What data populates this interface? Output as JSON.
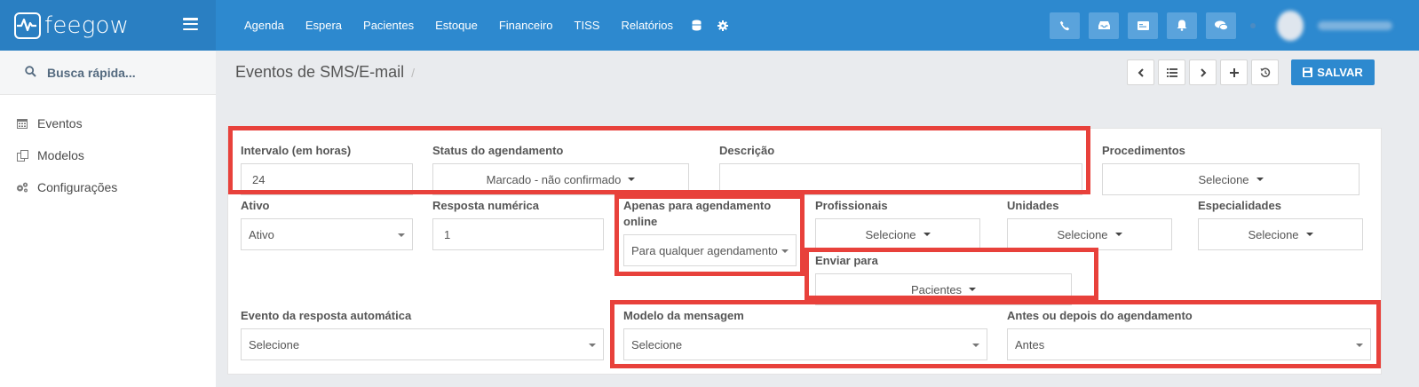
{
  "brand": {
    "name": "feegow"
  },
  "topnav": {
    "items": [
      "Agenda",
      "Espera",
      "Pacientes",
      "Estoque",
      "Financeiro",
      "TISS",
      "Relatórios"
    ]
  },
  "sidebar": {
    "search_placeholder": "Busca rápida...",
    "items": [
      {
        "label": "Eventos",
        "icon": "calendar-icon"
      },
      {
        "label": "Modelos",
        "icon": "copy-icon"
      },
      {
        "label": "Configurações",
        "icon": "cogs-icon"
      }
    ]
  },
  "page": {
    "title": "Eventos de SMS/E-mail",
    "separator": "/",
    "save_label": "SALVAR"
  },
  "form": {
    "intervalo": {
      "label": "Intervalo (em horas)",
      "value": "24"
    },
    "status": {
      "label": "Status do agendamento",
      "value": "Marcado - não confirmado"
    },
    "descricao": {
      "label": "Descrição",
      "value": ""
    },
    "procedimentos": {
      "label": "Procedimentos",
      "value": "Selecione"
    },
    "ativo": {
      "label": "Ativo",
      "value": "Ativo"
    },
    "resposta_numerica": {
      "label": "Resposta numérica",
      "value": "1"
    },
    "apenas_online": {
      "label_line1": "Apenas para agendamento",
      "label_line2": "online",
      "value": "Para qualquer agendamento"
    },
    "profissionais": {
      "label": "Profissionais",
      "value": "Selecione"
    },
    "unidades": {
      "label": "Unidades",
      "value": "Selecione"
    },
    "especialidades": {
      "label": "Especialidades",
      "value": "Selecione"
    },
    "enviar_para": {
      "label": "Enviar para",
      "value": "Pacientes"
    },
    "evento_resposta": {
      "label": "Evento da resposta automática",
      "value": "Selecione"
    },
    "modelo_mensagem": {
      "label": "Modelo da mensagem",
      "value": "Selecione"
    },
    "antes_depois": {
      "label": "Antes ou depois do agendamento",
      "value": "Antes"
    }
  },
  "colors": {
    "topbar": "#2d89cf",
    "highlight": "#e8413b",
    "save_button": "#2d89cf"
  }
}
